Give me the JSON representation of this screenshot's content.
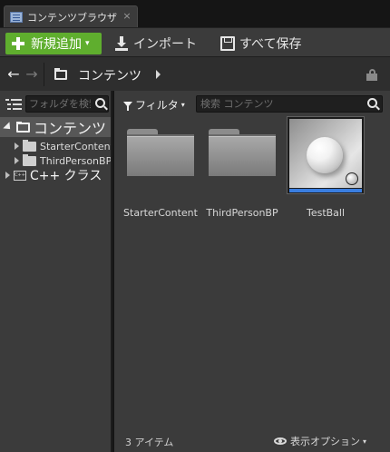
{
  "tab": {
    "title": "コンテンツブラウザ",
    "close": "×"
  },
  "toolbar": {
    "add_new_label": "新規追加",
    "add_new_caret": "▾",
    "import_label": "インポート",
    "save_all_label": "すべて保存"
  },
  "nav": {
    "back": "←",
    "forward": "→",
    "breadcrumb": "コンテンツ"
  },
  "sources": {
    "search_placeholder": "フォルダを検索",
    "tree": [
      {
        "label": "コンテンツ",
        "expanded": true,
        "selected": true
      },
      {
        "label": "StarterContent"
      },
      {
        "label": "ThirdPersonBP"
      },
      {
        "label": "C++ クラス"
      }
    ],
    "cpp_icon_text": "C++"
  },
  "content": {
    "filter_label": "フィルタ",
    "filter_caret": "▾",
    "search_placeholder": "検索 コンテンツ",
    "assets": [
      {
        "name": "StarterContent",
        "type": "folder"
      },
      {
        "name": "ThirdPersonBP",
        "type": "folder"
      },
      {
        "name": "TestBall",
        "type": "material"
      }
    ],
    "item_count": "3 アイテム",
    "view_options_label": "表示オプション",
    "view_options_caret": "▾"
  },
  "colors": {
    "add_new_button": "#5fae2e",
    "asset_type_bar": "#3a7ee0",
    "panel_bg": "#3b3b3b"
  },
  "icons": [
    "content-browser-icon",
    "plus-icon",
    "import-icon",
    "save-icon",
    "back-arrow-icon",
    "forward-arrow-icon",
    "folder-open-icon",
    "chevron-right-icon",
    "lock-icon",
    "tree-toggle-icon",
    "search-icon",
    "filter-icon",
    "eye-icon"
  ]
}
